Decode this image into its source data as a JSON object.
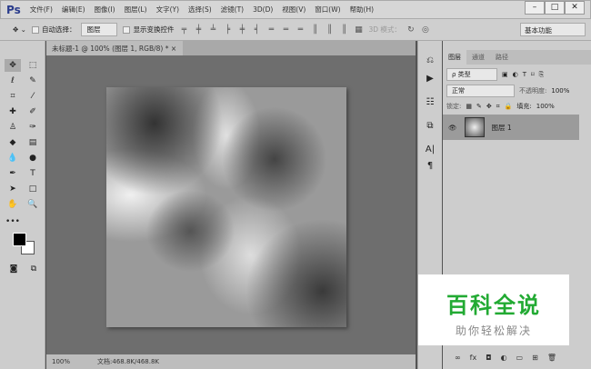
{
  "app": {
    "logo": "Ps",
    "menus": [
      "文件(F)",
      "编辑(E)",
      "图像(I)",
      "图层(L)",
      "文字(Y)",
      "选择(S)",
      "滤镜(T)",
      "3D(D)",
      "视图(V)",
      "窗口(W)",
      "帮助(H)"
    ],
    "window": [
      "–",
      "□",
      "✕"
    ]
  },
  "options": {
    "auto_select": "自动选择：",
    "auto_select_value": "图层",
    "show_transform": "显示变换控件",
    "mode_3d": "3D 模式：",
    "workspace": "基本功能"
  },
  "document": {
    "tab": "未标题-1 @ 100% (图层 1, RGB/8) *",
    "close": "×",
    "zoom": "100%",
    "doc_info": "文档:468.8K/468.8K"
  },
  "layers_panel": {
    "tabs": [
      "图层",
      "通道",
      "路径"
    ],
    "filter": "ρ 类型",
    "blend": "正常",
    "opacity_label": "不透明度:",
    "opacity": "100%",
    "lock_label": "锁定:",
    "fill_label": "填充:",
    "fill": "100%",
    "layer_name": "图层 1",
    "footer": [
      "∞",
      "fx",
      "◘",
      "◐",
      "▭",
      "⊞",
      "🗑"
    ]
  },
  "watermark": {
    "title": "百科全说",
    "subtitle": "助你轻松解决"
  }
}
